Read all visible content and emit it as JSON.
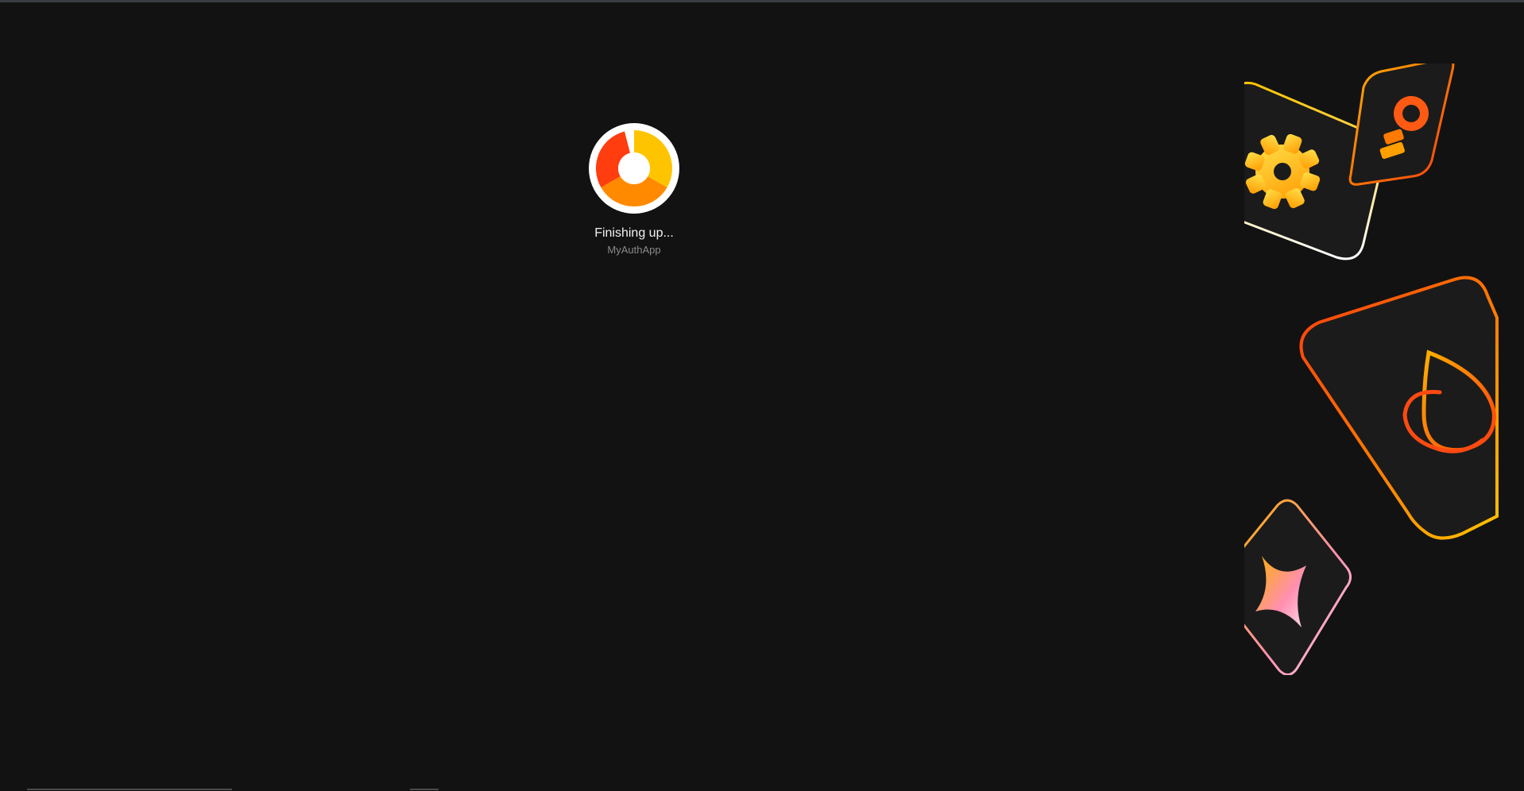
{
  "status": {
    "message": "Finishing up...",
    "app_name": "MyAuthApp"
  },
  "colors": {
    "background": "#121212",
    "accent_red": "#ff3d0f",
    "accent_orange": "#ff8a00",
    "accent_yellow": "#ffc400",
    "tile_fill": "#1b1b1b"
  },
  "icons": [
    "spinner-icon",
    "gear-icon",
    "leaf-icon",
    "sparkle-icon",
    "game-icon"
  ]
}
